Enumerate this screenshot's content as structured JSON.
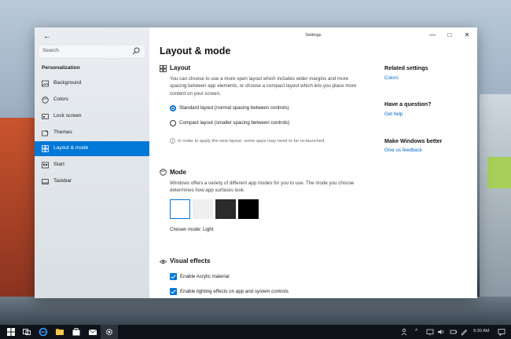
{
  "window": {
    "title": "Settings"
  },
  "sidebar": {
    "search_placeholder": "Search",
    "category": "Personalization",
    "items": [
      {
        "label": "Background",
        "icon": "image-icon"
      },
      {
        "label": "Colors",
        "icon": "palette-icon"
      },
      {
        "label": "Lock screen",
        "icon": "lock-screen-icon"
      },
      {
        "label": "Themes",
        "icon": "themes-icon"
      },
      {
        "label": "Layout & mode",
        "icon": "layout-icon",
        "active": true
      },
      {
        "label": "Start",
        "icon": "start-icon"
      },
      {
        "label": "Taskbar",
        "icon": "taskbar-icon"
      }
    ]
  },
  "main": {
    "title": "Layout & mode",
    "layout": {
      "heading": "Layout",
      "description": "You can choose to use a more open layout which includes wider margins and more spacing between app elements, or choose a compact layout which lets you place more content on your screen.",
      "options": [
        {
          "label": "Standard layout (normal spacing between controls)",
          "selected": true
        },
        {
          "label": "Compact layout (smaller spacing between controls)",
          "selected": false
        }
      ],
      "note": "In order to apply the new layout, some apps may need to be re-launched."
    },
    "mode": {
      "heading": "Mode",
      "description": "Windows offers a variety of different app modes for you to use. The mode you choose determines how app surfaces look.",
      "swatches": [
        "#ffffff",
        "#f0f0f0",
        "#2b2b2b",
        "#000000"
      ],
      "chosen": "Chosen mode: Light"
    },
    "visual_effects": {
      "heading": "Visual effects",
      "checkboxes": [
        {
          "label": "Enable Acrylic material",
          "checked": true
        },
        {
          "label": "Enable lighting effects on app and system controls",
          "checked": true
        }
      ]
    }
  },
  "side": {
    "related_heading": "Related settings",
    "related_link": "Colors",
    "question_heading": "Have a question?",
    "question_link": "Get help",
    "better_heading": "Make Windows better",
    "better_link": "Give us feedback"
  },
  "taskbar": {
    "time": "9:30 AM",
    "accent": "#0078d7"
  }
}
